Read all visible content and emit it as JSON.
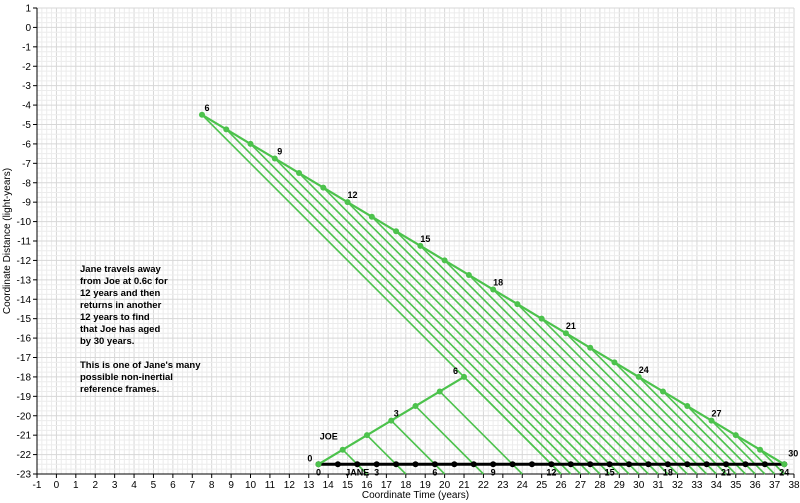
{
  "chart_data": {
    "type": "line",
    "title": "",
    "xlabel": "Coordinate Time (years)",
    "ylabel": "Coordinate Distance (light-years)",
    "xlim": [
      -1,
      38
    ],
    "ylim": [
      -23,
      1
    ],
    "grid": true,
    "colors": {
      "green": "#4cc24c",
      "black": "#000000",
      "grid": "#d7d7d7"
    },
    "series": [
      {
        "name": "",
        "color": "#000000",
        "points": [
          [
            13.5,
            -22.5
          ],
          [
            14.5,
            -22.5
          ],
          [
            15.5,
            -22.5
          ],
          [
            16.5,
            -22.5
          ],
          [
            17.5,
            -22.5
          ],
          [
            18.5,
            -22.5
          ],
          [
            19.5,
            -22.5
          ],
          [
            20.5,
            -22.5
          ],
          [
            21.5,
            -22.5
          ],
          [
            22.5,
            -22.5
          ],
          [
            23.5,
            -22.5
          ],
          [
            24.5,
            -22.5
          ],
          [
            25.5,
            -22.5
          ],
          [
            26.5,
            -22.5
          ],
          [
            27.5,
            -22.5
          ],
          [
            28.5,
            -22.5
          ],
          [
            29.5,
            -22.5
          ],
          [
            30.5,
            -22.5
          ],
          [
            31.5,
            -22.5
          ],
          [
            32.5,
            -22.5
          ],
          [
            33.5,
            -22.5
          ],
          [
            34.5,
            -22.5
          ],
          [
            35.5,
            -22.5
          ],
          [
            36.5,
            -22.5
          ],
          [
            37.5,
            -22.5
          ]
        ]
      },
      {
        "name": "",
        "color": "#4cc24c",
        "points": [
          [
            13.5,
            -22.5
          ],
          [
            14.75,
            -21.75
          ],
          [
            16.0,
            -21.0
          ],
          [
            17.25,
            -20.25
          ],
          [
            18.5,
            -19.5
          ],
          [
            19.75,
            -18.75
          ],
          [
            21.0,
            -18.0
          ]
        ]
      },
      {
        "name": "",
        "color": "#4cc24c",
        "points": [
          [
            7.5,
            -4.5
          ],
          [
            8.75,
            -5.25
          ],
          [
            10.0,
            -6.0
          ],
          [
            11.25,
            -6.75
          ],
          [
            12.5,
            -7.5
          ],
          [
            13.75,
            -8.25
          ],
          [
            15.0,
            -9.0
          ],
          [
            16.25,
            -9.75
          ],
          [
            17.5,
            -10.5
          ],
          [
            18.75,
            -11.25
          ],
          [
            20.0,
            -12.0
          ],
          [
            21.25,
            -12.75
          ],
          [
            22.5,
            -13.5
          ],
          [
            23.75,
            -14.25
          ],
          [
            25.0,
            -15.0
          ],
          [
            26.25,
            -15.75
          ],
          [
            27.5,
            -16.5
          ],
          [
            28.75,
            -17.25
          ],
          [
            30.0,
            -18.0
          ],
          [
            31.25,
            -18.75
          ],
          [
            32.5,
            -19.5
          ],
          [
            33.75,
            -20.25
          ],
          [
            35.0,
            -21.0
          ],
          [
            36.25,
            -21.75
          ],
          [
            37.5,
            -22.5
          ]
        ]
      }
    ],
    "connectors": [
      [
        [
          14.75,
          -21.75
        ],
        [
          16.0,
          -23.0
        ]
      ],
      [
        [
          16.0,
          -21.0
        ],
        [
          18.0,
          -23.0
        ]
      ],
      [
        [
          17.25,
          -20.25
        ],
        [
          20.0,
          -23.0
        ]
      ],
      [
        [
          18.5,
          -19.5
        ],
        [
          22.0,
          -23.0
        ]
      ],
      [
        [
          19.75,
          -18.75
        ],
        [
          24.0,
          -23.0
        ]
      ],
      [
        [
          21.0,
          -18.0
        ],
        [
          26.0,
          -23.0
        ]
      ],
      [
        [
          7.5,
          -4.5
        ],
        [
          26.0,
          -23.0
        ]
      ],
      [
        [
          8.75,
          -5.25
        ],
        [
          26.5,
          -23.0
        ]
      ],
      [
        [
          10.0,
          -6.0
        ],
        [
          27.0,
          -23.0
        ]
      ],
      [
        [
          11.25,
          -6.75
        ],
        [
          27.5,
          -23.0
        ]
      ],
      [
        [
          12.5,
          -7.5
        ],
        [
          28.0,
          -23.0
        ]
      ],
      [
        [
          13.75,
          -8.25
        ],
        [
          28.5,
          -23.0
        ]
      ],
      [
        [
          15.0,
          -9.0
        ],
        [
          29.0,
          -23.0
        ]
      ],
      [
        [
          16.25,
          -9.75
        ],
        [
          29.5,
          -23.0
        ]
      ],
      [
        [
          17.5,
          -10.5
        ],
        [
          30.0,
          -23.0
        ]
      ],
      [
        [
          18.75,
          -11.25
        ],
        [
          30.5,
          -23.0
        ]
      ],
      [
        [
          20.0,
          -12.0
        ],
        [
          31.0,
          -23.0
        ]
      ],
      [
        [
          21.25,
          -12.75
        ],
        [
          31.5,
          -23.0
        ]
      ],
      [
        [
          22.5,
          -13.5
        ],
        [
          32.0,
          -23.0
        ]
      ],
      [
        [
          23.75,
          -14.25
        ],
        [
          32.5,
          -23.0
        ]
      ],
      [
        [
          25.0,
          -15.0
        ],
        [
          33.0,
          -23.0
        ]
      ],
      [
        [
          26.25,
          -15.75
        ],
        [
          33.5,
          -23.0
        ]
      ],
      [
        [
          27.5,
          -16.5
        ],
        [
          34.0,
          -23.0
        ]
      ],
      [
        [
          28.75,
          -17.25
        ],
        [
          34.5,
          -23.0
        ]
      ],
      [
        [
          30.0,
          -18.0
        ],
        [
          35.0,
          -23.0
        ]
      ],
      [
        [
          31.25,
          -18.75
        ],
        [
          35.5,
          -23.0
        ]
      ],
      [
        [
          32.5,
          -19.5
        ],
        [
          36.0,
          -23.0
        ]
      ],
      [
        [
          33.75,
          -20.25
        ],
        [
          36.5,
          -23.0
        ]
      ],
      [
        [
          35.0,
          -21.0
        ],
        [
          37.0,
          -23.0
        ]
      ],
      [
        [
          36.25,
          -21.75
        ],
        [
          37.5,
          -23.0
        ]
      ]
    ],
    "point_labels": [
      {
        "text": "6",
        "x": 7.5,
        "y": -4.5,
        "anchor": "above"
      },
      {
        "text": "9",
        "x": 11.25,
        "y": -6.75,
        "anchor": "above"
      },
      {
        "text": "12",
        "x": 15.0,
        "y": -9.0,
        "anchor": "above"
      },
      {
        "text": "15",
        "x": 18.75,
        "y": -11.25,
        "anchor": "above"
      },
      {
        "text": "18",
        "x": 22.5,
        "y": -13.5,
        "anchor": "above"
      },
      {
        "text": "21",
        "x": 26.25,
        "y": -15.75,
        "anchor": "above"
      },
      {
        "text": "24",
        "x": 30.0,
        "y": -18.0,
        "anchor": "above"
      },
      {
        "text": "27",
        "x": 33.75,
        "y": -20.25,
        "anchor": "above"
      },
      {
        "text": "30",
        "x": 37.5,
        "y": -22.5,
        "anchor": "right"
      },
      {
        "text": "0",
        "x": 13.5,
        "y": -22.5,
        "anchor": "left"
      },
      {
        "text": "3",
        "x": 17.25,
        "y": -20.25,
        "anchor": "above"
      },
      {
        "text": "6",
        "x": 21.0,
        "y": -18.0,
        "anchor": "left"
      },
      {
        "text": "JOE",
        "x": 14.75,
        "y": -21.75,
        "anchor": "joe"
      },
      {
        "text": "0",
        "x": 13.5,
        "y": -22.5,
        "anchor": "below"
      },
      {
        "text": "JANE",
        "x": 15.5,
        "y": -22.5,
        "anchor": "below"
      },
      {
        "text": "3",
        "x": 16.5,
        "y": -22.5,
        "anchor": "below"
      },
      {
        "text": "6",
        "x": 19.5,
        "y": -22.5,
        "anchor": "below"
      },
      {
        "text": "9",
        "x": 22.5,
        "y": -22.5,
        "anchor": "below"
      },
      {
        "text": "12",
        "x": 25.5,
        "y": -22.5,
        "anchor": "below"
      },
      {
        "text": "15",
        "x": 28.5,
        "y": -22.5,
        "anchor": "below"
      },
      {
        "text": "18",
        "x": 31.5,
        "y": -22.5,
        "anchor": "below"
      },
      {
        "text": "21",
        "x": 34.5,
        "y": -22.5,
        "anchor": "below"
      },
      {
        "text": "24",
        "x": 37.5,
        "y": -22.5,
        "anchor": "below"
      }
    ]
  },
  "notes": [
    "Jane travels away",
    "from Joe at 0.6c for",
    "12 years and then",
    "returns in another",
    "12 years to find",
    "that Joe has aged",
    "by 30 years.",
    "This is one of Jane's many",
    "possible non-inertial",
    "reference frames."
  ]
}
